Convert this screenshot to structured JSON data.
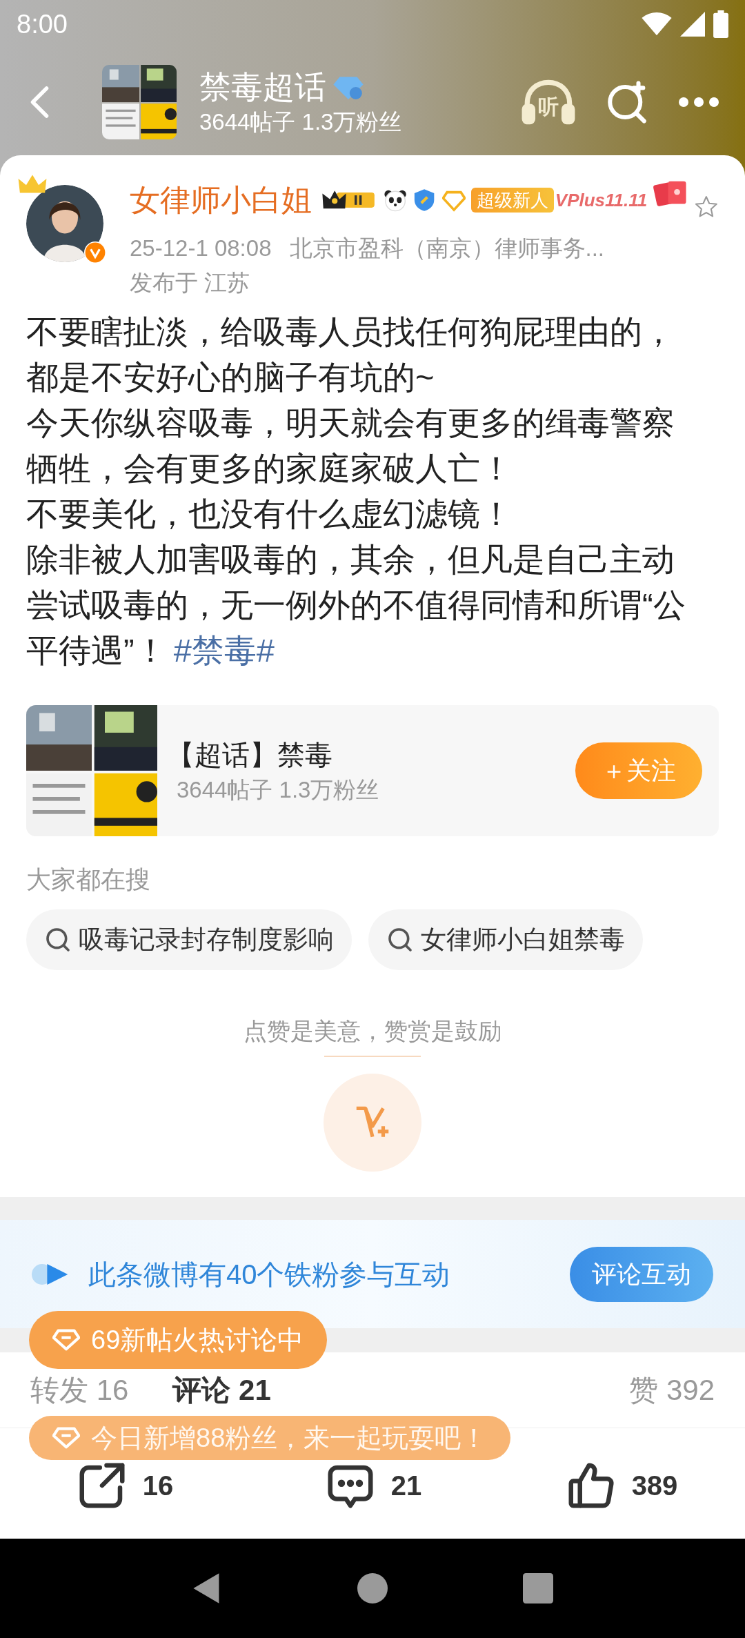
{
  "status_bar": {
    "time": "8:00"
  },
  "header": {
    "title": "禁毒超话",
    "subtitle": "3644帖子 1.3万粉丝",
    "listen_label": "听"
  },
  "post": {
    "author": "女律师小白姐",
    "badge": "超级新人",
    "promo": "VPlus11.11",
    "starred": false,
    "date": "25-12-1 08:08",
    "source": "北京市盈科（南京）律师事务...",
    "location": "发布于 江苏",
    "paragraphs": [
      "不要瞎扯淡，给吸毒人员找任何狗屁理由的，都是不安好心的脑子有坑的~",
      "今天你纵容吸毒，明天就会有更多的缉毒警察牺牲，会有更多的家庭家破人亡！",
      "不要美化，也没有什么虚幻滤镜！",
      "除非被人加害吸毒的，其余，但凡是自己主动尝试吸毒的，无一例外的不值得同情和所谓“公平待遇”！"
    ],
    "hashtag": "#禁毒#"
  },
  "topic_card": {
    "title": "【超话】禁毒",
    "subtitle": "3644帖子 1.3万粉丝",
    "follow_button": "＋关注"
  },
  "searches": {
    "heading": "大家都在搜",
    "items": [
      "吸毒记录封存制度影响",
      "女律师小白姐禁毒"
    ]
  },
  "reward": {
    "caption": "点赞是美意，赞赏是鼓励"
  },
  "fan_banner": {
    "text": "此条微博有40个铁粉参与互动",
    "button": "评论互动"
  },
  "tabs": [
    {
      "label": "转发 16",
      "selected": false
    },
    {
      "label": "评论 21",
      "selected": true
    },
    {
      "label": "赞 392",
      "selected": false
    }
  ],
  "toasts": [
    {
      "text": "69新帖火热讨论中",
      "fading": false
    },
    {
      "text": "今日新增88粉丝，来一起玩耍吧！",
      "fading": true
    }
  ],
  "actions": [
    {
      "kind": "repost",
      "count": "16"
    },
    {
      "kind": "comment",
      "count": "21"
    },
    {
      "kind": "like",
      "count": "389"
    }
  ]
}
